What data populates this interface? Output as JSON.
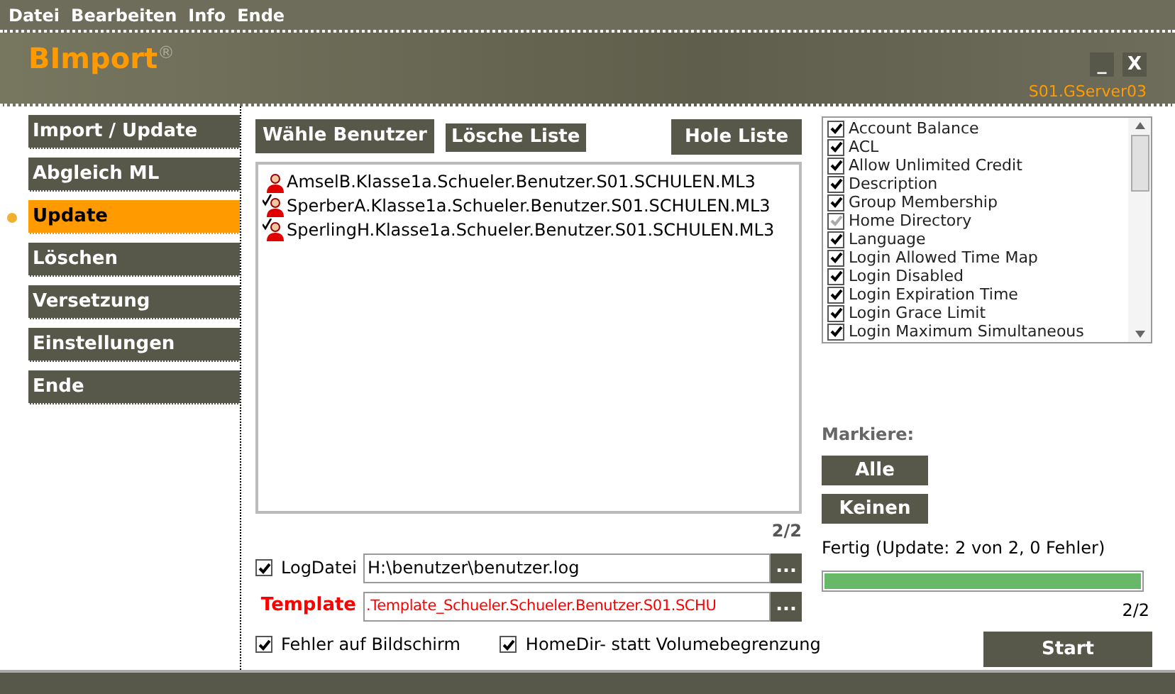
{
  "menu": [
    "Datei",
    "Bearbeiten",
    "Info",
    "Ende"
  ],
  "header": {
    "title": "BImport",
    "mark": "®",
    "server": "S01.GServer03",
    "buttons": [
      "_",
      "X"
    ]
  },
  "sidebar": [
    {
      "label": "Import / Update",
      "selected": false
    },
    {
      "label": "Abgleich ML",
      "selected": false
    },
    {
      "label": "Update",
      "selected": true
    },
    {
      "label": "Löschen",
      "selected": false
    },
    {
      "label": "Versetzung",
      "selected": false
    },
    {
      "label": "Einstellungen",
      "selected": false
    },
    {
      "label": "Ende",
      "selected": false
    }
  ],
  "toolbar": {
    "choose": "Wähle Benutzer",
    "clear": "Lösche Liste",
    "fetch": "Hole Liste"
  },
  "users": [
    {
      "name": "AmselB.Klasse1a.Schueler.Benutzer.S01.SCHULEN.ML3",
      "checked": false
    },
    {
      "name": "SperberA.Klasse1a.Schueler.Benutzer.S01.SCHULEN.ML3",
      "checked": true
    },
    {
      "name": "SperlingH.Klasse1a.Schueler.Benutzer.S01.SCHULEN.ML3",
      "checked": true
    }
  ],
  "user_count": "2/2",
  "attributes": [
    {
      "label": "Account Balance",
      "checked": true,
      "disabled": false
    },
    {
      "label": "ACL",
      "checked": true,
      "disabled": false
    },
    {
      "label": "Allow Unlimited Credit",
      "checked": true,
      "disabled": false
    },
    {
      "label": "Description",
      "checked": true,
      "disabled": false
    },
    {
      "label": "Group Membership",
      "checked": true,
      "disabled": false
    },
    {
      "label": "Home Directory",
      "checked": true,
      "disabled": true
    },
    {
      "label": "Language",
      "checked": true,
      "disabled": false
    },
    {
      "label": "Login Allowed Time Map",
      "checked": true,
      "disabled": false
    },
    {
      "label": "Login Disabled",
      "checked": true,
      "disabled": false
    },
    {
      "label": "Login Expiration Time",
      "checked": true,
      "disabled": false
    },
    {
      "label": "Login Grace Limit",
      "checked": true,
      "disabled": false
    },
    {
      "label": "Login Maximum Simultaneous",
      "checked": true,
      "disabled": false
    }
  ],
  "mark_label": "Markiere:",
  "mark_buttons": [
    "Alle",
    "Keinen"
  ],
  "status": "Fertig (Update: 2 von 2, 0 Fehler)",
  "progress": {
    "level": 1,
    "reading": "2/2"
  },
  "logfile": {
    "label": "LogDatei",
    "checked": true,
    "value": "H:\\benutzer\\benutzer.log",
    "browse": "..."
  },
  "template": {
    "label": "Template",
    "value": ".Template_Schueler.Schueler.Benutzer.S01.SCHU",
    "browse": "..."
  },
  "options": [
    {
      "label": "Fehler auf Bildschirm",
      "checked": true
    },
    {
      "label": "HomeDir- statt Volumebegrenzung",
      "checked": true
    }
  ],
  "start": "Start"
}
